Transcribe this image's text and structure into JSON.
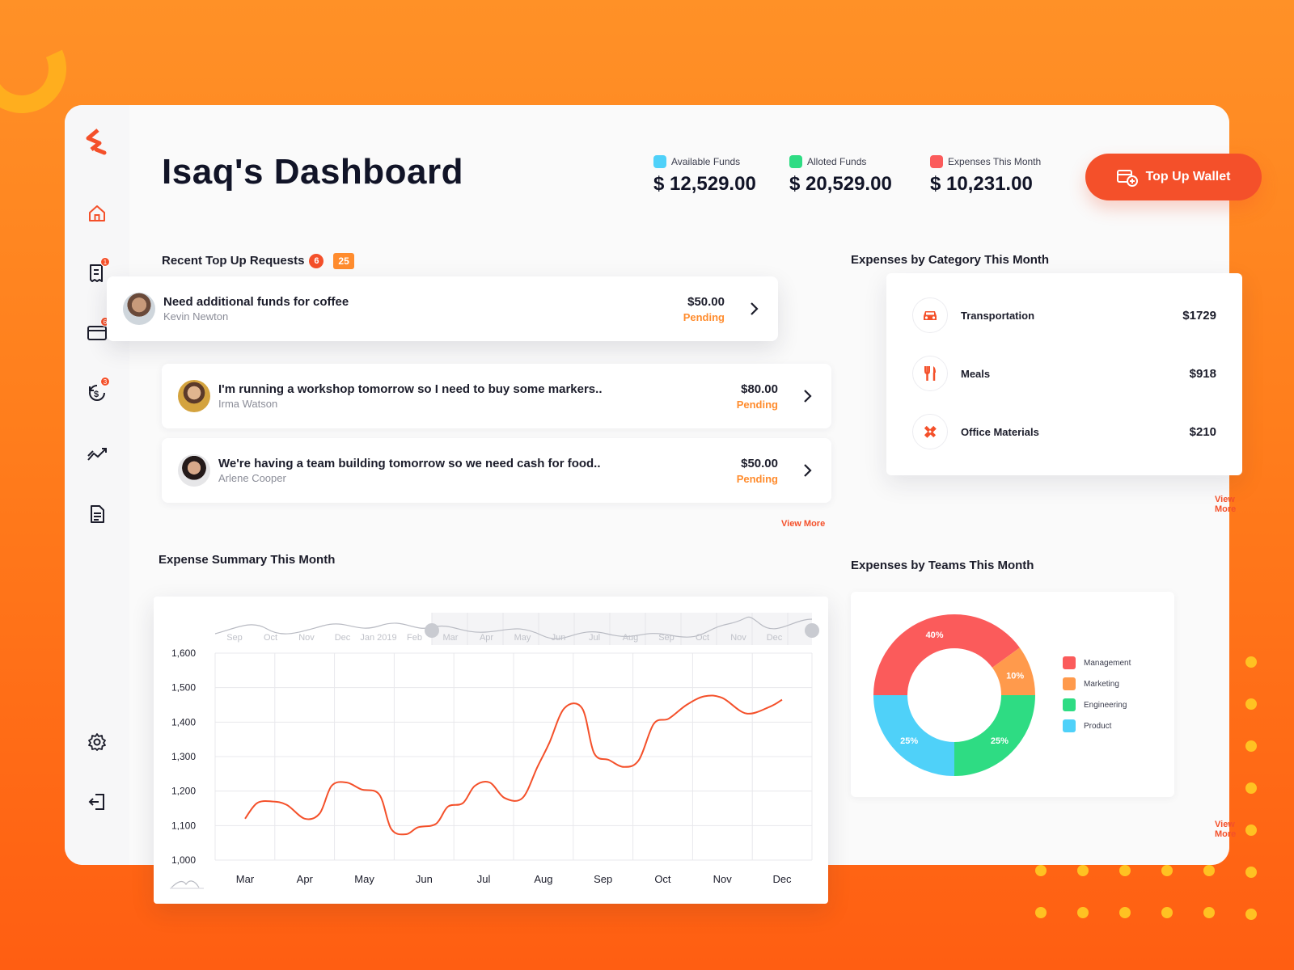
{
  "header": {
    "title": "Isaq's Dashboard",
    "stats": [
      {
        "label": "Available Funds",
        "value": "$ 12,529.00",
        "color": "#4fd1f9"
      },
      {
        "label": "Alloted Funds",
        "value": "$ 20,529.00",
        "color": "#2edc83"
      },
      {
        "label": "Expenses This Month",
        "value": "$ 10,231.00",
        "color": "#fb5b5b"
      }
    ],
    "topup_label": "Top Up Wallet"
  },
  "sidebar": {
    "items": [
      {
        "icon": "home-icon"
      },
      {
        "icon": "receipt-icon",
        "badge": "1"
      },
      {
        "icon": "card-icon",
        "badge": "6"
      },
      {
        "icon": "refund-icon",
        "badge": "3"
      },
      {
        "icon": "trend-icon"
      },
      {
        "icon": "document-icon"
      },
      {
        "icon": "gear-icon"
      },
      {
        "icon": "logout-icon"
      }
    ]
  },
  "requests": {
    "title": "Recent Top Up Requests",
    "badge": "6",
    "count": "25",
    "view_more": "View More",
    "items": [
      {
        "title": "Need additional funds for coffee",
        "name": "Kevin Newton",
        "amount": "$50.00",
        "status": "Pending"
      },
      {
        "title": "I'm running a workshop tomorrow so I need to buy some markers..",
        "name": "Irma Watson",
        "amount": "$80.00",
        "status": "Pending"
      },
      {
        "title": "We're having a team building tomorrow so we need cash for food..",
        "name": "Arlene Cooper",
        "amount": "$50.00",
        "status": "Pending"
      }
    ]
  },
  "categories": {
    "title": "Expenses by Category This Month",
    "view_more": "View More",
    "items": [
      {
        "label": "Transportation",
        "value": "$1729",
        "icon": "car-icon"
      },
      {
        "label": "Meals",
        "value": "$918",
        "icon": "fork-knife-icon"
      },
      {
        "label": "Office Materials",
        "value": "$210",
        "icon": "pencil-ruler-icon"
      }
    ]
  },
  "summary": {
    "title": "Expense Summary This Month"
  },
  "teams": {
    "title": "Expenses by Teams This Month",
    "view_more": "View More"
  },
  "chart_data": [
    {
      "type": "line",
      "title": "Expense Summary This Month",
      "x": [
        "Mar",
        "Apr",
        "May",
        "Jun",
        "Jul",
        "Aug",
        "Sep",
        "Oct",
        "Nov",
        "Dec"
      ],
      "ylim": [
        1000,
        1600
      ],
      "yticks": [
        "1,600",
        "1,500",
        "1,400",
        "1,300",
        "1,200",
        "1,100",
        "1,000"
      ],
      "navigator_labels": [
        "Sep",
        "Oct",
        "Nov",
        "Dec",
        "Jan 2019",
        "Feb",
        "Mar",
        "Apr",
        "May",
        "Jun",
        "Jul",
        "Aug",
        "Sep",
        "Oct",
        "Nov",
        "Dec"
      ],
      "grid": true,
      "series": [
        {
          "color": "#f4502a",
          "points": [
            [
              0.0,
              1120
            ],
            [
              0.2,
              1165
            ],
            [
              0.45,
              1170
            ],
            [
              0.7,
              1160
            ],
            [
              1.0,
              1120
            ],
            [
              1.25,
              1135
            ],
            [
              1.45,
              1215
            ],
            [
              1.7,
              1225
            ],
            [
              1.95,
              1205
            ],
            [
              2.25,
              1190
            ],
            [
              2.45,
              1090
            ],
            [
              2.7,
              1075
            ],
            [
              2.9,
              1095
            ],
            [
              3.2,
              1105
            ],
            [
              3.4,
              1155
            ],
            [
              3.65,
              1165
            ],
            [
              3.85,
              1215
            ],
            [
              4.1,
              1225
            ],
            [
              4.35,
              1180
            ],
            [
              4.65,
              1180
            ],
            [
              4.9,
              1270
            ],
            [
              5.1,
              1340
            ],
            [
              5.35,
              1440
            ],
            [
              5.65,
              1440
            ],
            [
              5.85,
              1310
            ],
            [
              6.1,
              1290
            ],
            [
              6.35,
              1270
            ],
            [
              6.6,
              1290
            ],
            [
              6.85,
              1395
            ],
            [
              7.1,
              1410
            ],
            [
              7.4,
              1450
            ],
            [
              7.7,
              1475
            ],
            [
              8.0,
              1470
            ],
            [
              8.4,
              1425
            ],
            [
              8.8,
              1445
            ],
            [
              9.0,
              1465
            ]
          ]
        }
      ]
    },
    {
      "type": "pie",
      "title": "Expenses by Teams This Month",
      "categories": [
        "Management",
        "Marketing",
        "Engineering",
        "Product"
      ],
      "values": [
        40,
        10,
        25,
        25
      ],
      "labels": [
        "40%",
        "10%",
        "25%",
        "25%"
      ],
      "colors": [
        "#fb5b5b",
        "#ff9a4c",
        "#2edc83",
        "#4fd1f9"
      ]
    }
  ]
}
